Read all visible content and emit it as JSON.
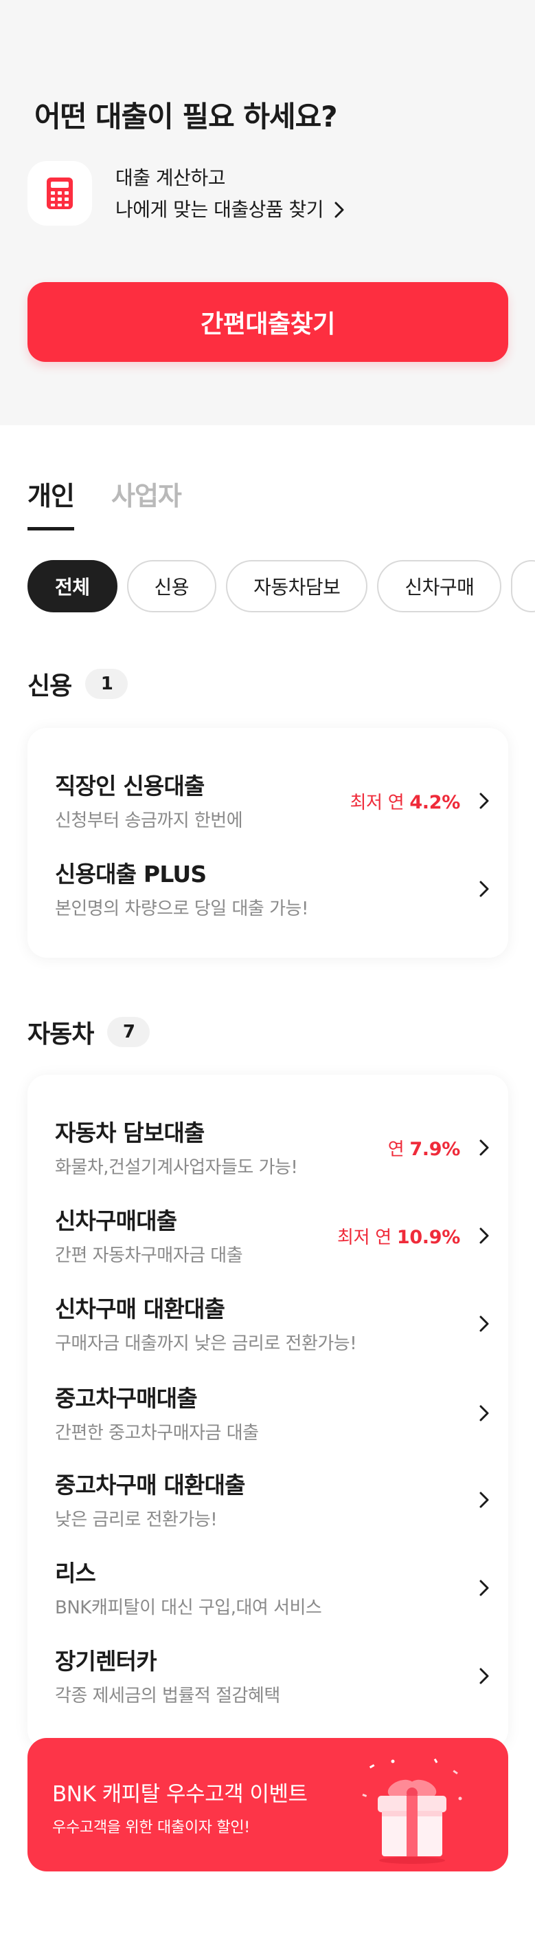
{
  "header": {
    "headline": "어떤 대출이 필요 하세요?",
    "calculator_icon": "calculator-icon",
    "calc_line1": "대출 계산하고",
    "calc_line2": "나에게 맞는 대출상품 찾기",
    "cta_label": "간편대출찾기"
  },
  "tabs": [
    {
      "label": "개인",
      "active": true
    },
    {
      "label": "사업자",
      "active": false
    }
  ],
  "chips": [
    "전체",
    "신용",
    "자동차담보",
    "신차구매",
    ""
  ],
  "credit": {
    "title": "신용",
    "count": "1",
    "items": [
      {
        "title": "직장인 신용대출",
        "sub": "신청부터 송금까지 한번에",
        "rate_prefix": "최저 연",
        "rate": "4.2%"
      },
      {
        "title": "신용대출 PLUS",
        "sub": "본인명의 차량으로 당일 대출 가능!",
        "rate_prefix": "",
        "rate": ""
      }
    ]
  },
  "auto": {
    "title": "자동차",
    "count": "7",
    "items": [
      {
        "title": "자동차 담보대출",
        "sub": "화물차,건설기계사업자들도 가능!",
        "rate_prefix": "연",
        "rate": "7.9%"
      },
      {
        "title": "신차구매대출",
        "sub": "간편 자동차구매자금 대출",
        "rate_prefix": "최저 연",
        "rate": "10.9%"
      },
      {
        "title": "신차구매 대환대출",
        "sub": "구매자금 대출까지 낮은 금리로 전환가능!",
        "rate_prefix": "",
        "rate": ""
      },
      {
        "title": "중고차구매대출",
        "sub": "간편한 중고차구매자금 대출",
        "rate_prefix": "",
        "rate": ""
      },
      {
        "title": "중고차구매 대환대출",
        "sub": "낮은 금리로 전환가능!",
        "rate_prefix": "",
        "rate": ""
      },
      {
        "title": "리스",
        "sub": "BNK캐피탈이 대신 구입,대여 서비스",
        "rate_prefix": "",
        "rate": ""
      },
      {
        "title": "장기렌터카",
        "sub": "각종 제세금의 법률적 절감혜택",
        "rate_prefix": "",
        "rate": ""
      }
    ]
  },
  "banner": {
    "title": "BNK 캐피탈 우수고객 이벤트",
    "sub": "우수고객을 위한 대출이자 할인!",
    "icon": "gift-box-icon"
  },
  "colors": {
    "accent": "#fd2e40",
    "rate_text": "#ef2b3a",
    "top_bg": "#f6f6f6",
    "chip_active": "#1f1f1f"
  }
}
